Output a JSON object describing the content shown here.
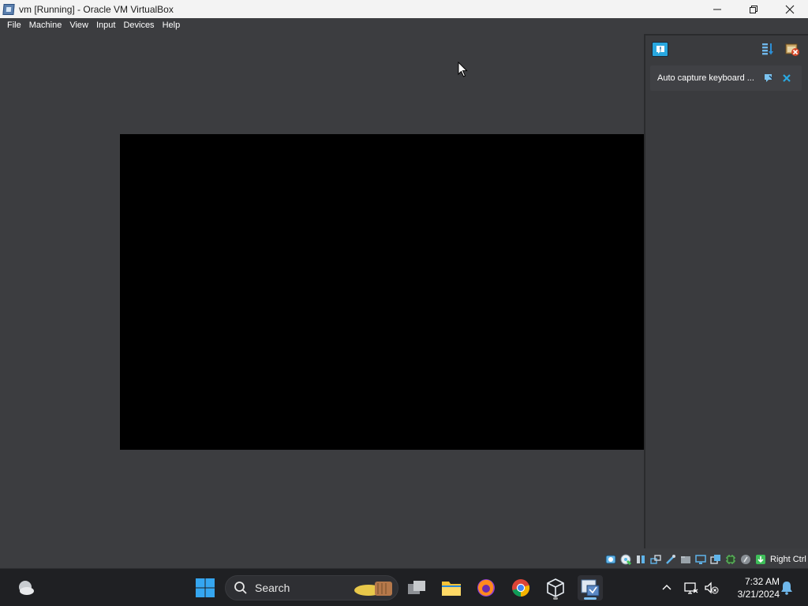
{
  "window": {
    "title": "vm [Running] - Oracle VM VirtualBox",
    "icon": "virtualbox-icon"
  },
  "menu": {
    "items": [
      "File",
      "Machine",
      "View",
      "Input",
      "Devices",
      "Help"
    ]
  },
  "notification_center": {
    "message": "Auto capture keyboard ..."
  },
  "statusbar": {
    "host_key": "Right Ctrl"
  },
  "taskbar": {
    "search_placeholder": "Search",
    "clock_time": "7:32 AM",
    "clock_date": "3/21/2024"
  },
  "colors": {
    "window_bg": "#3c3d40",
    "guest_display": "#000000",
    "accent_blue": "#29a8e0",
    "taskbar_bg": "#1f2023"
  }
}
